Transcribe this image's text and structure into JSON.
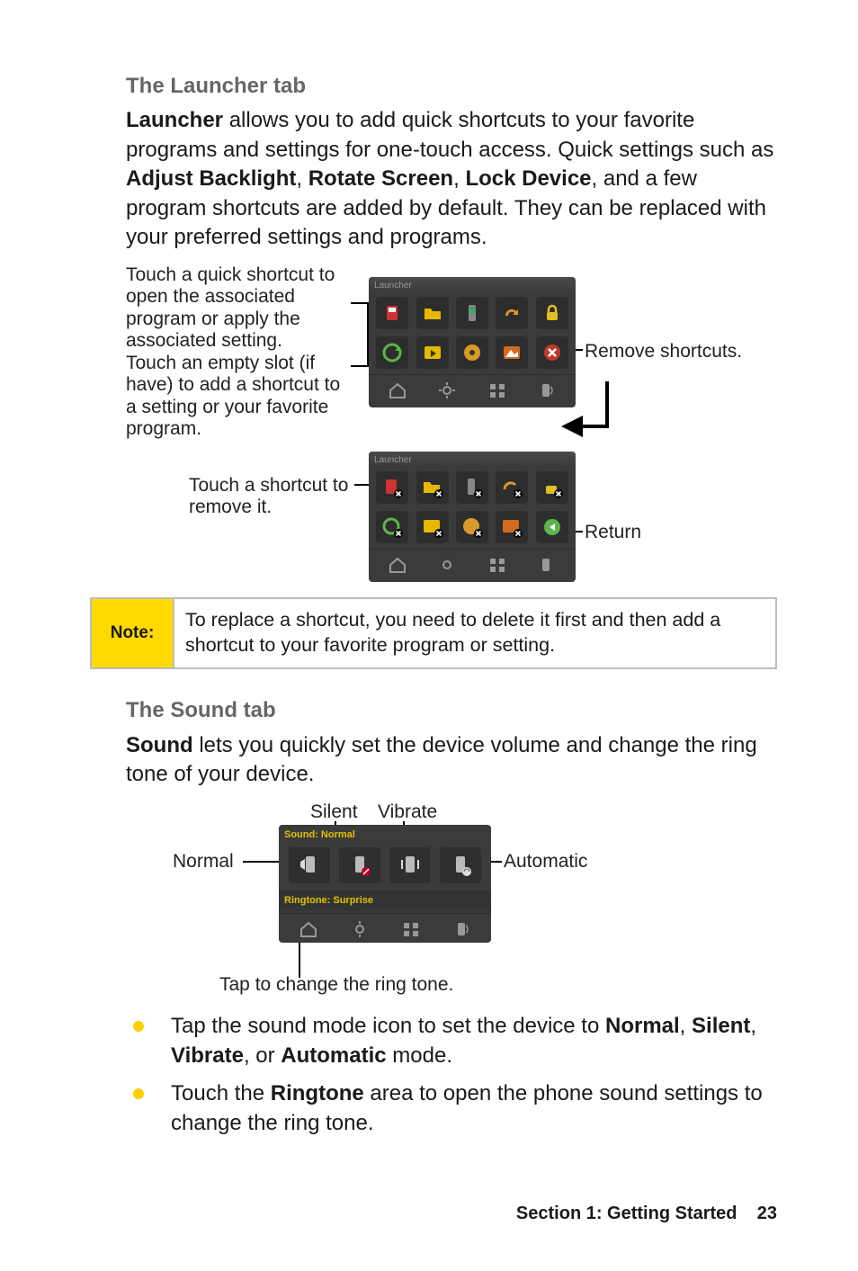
{
  "launcher": {
    "heading": "The Launcher tab",
    "paragraph_parts": {
      "p1a": "Launcher",
      "p1b": " allows you to add quick shortcuts to your favorite programs and settings for one-touch access. Quick settings such as ",
      "p1c": "Adjust Backlight",
      "p1d": ", ",
      "p1e": "Rotate Screen",
      "p1f": ", ",
      "p1g": "Lock Device",
      "p1h": ", and a few program shortcuts are added by default. They can be replaced with your preferred settings and programs."
    },
    "callouts": {
      "c1": "Touch a quick shortcut to open the associated program or apply the associated setting.",
      "c2": "Touch an empty slot (if have)  to add a shortcut to a setting or your favorite program.",
      "c3": "Remove shortcuts.",
      "c4": "Touch a shortcut to remove it.",
      "c5": "Return"
    },
    "shot_title": "Launcher"
  },
  "note": {
    "label": "Note:",
    "text": "To replace a shortcut, you need to delete it first and then add a shortcut to your favorite program or setting."
  },
  "sound": {
    "heading": "The Sound tab",
    "paragraph_parts": {
      "p1a": "Sound",
      "p1b": " lets you quickly set the device volume and change the ring tone of your device."
    },
    "callouts": {
      "silent": "Silent",
      "vibrate": "Vibrate",
      "normal": "Normal",
      "automatic": "Automatic",
      "tap_ring": "Tap to change the ring tone."
    },
    "shot_heading": "Sound: Normal",
    "ringtone": "Ringtone: Surprise",
    "bullets": {
      "b1a": "Tap the sound mode icon to set the device to ",
      "b1b": "Normal",
      "b1c": ", ",
      "b1d": "Silent",
      "b1e": ", ",
      "b1f": "Vibrate",
      "b1g": ", or ",
      "b1h": "Automatic",
      "b1i": " mode.",
      "b2a": "Touch the ",
      "b2b": "Ringtone",
      "b2c": " area to open the phone sound settings to change the ring tone."
    }
  },
  "footer": {
    "section": "Section 1: Getting Started",
    "page": "23"
  }
}
